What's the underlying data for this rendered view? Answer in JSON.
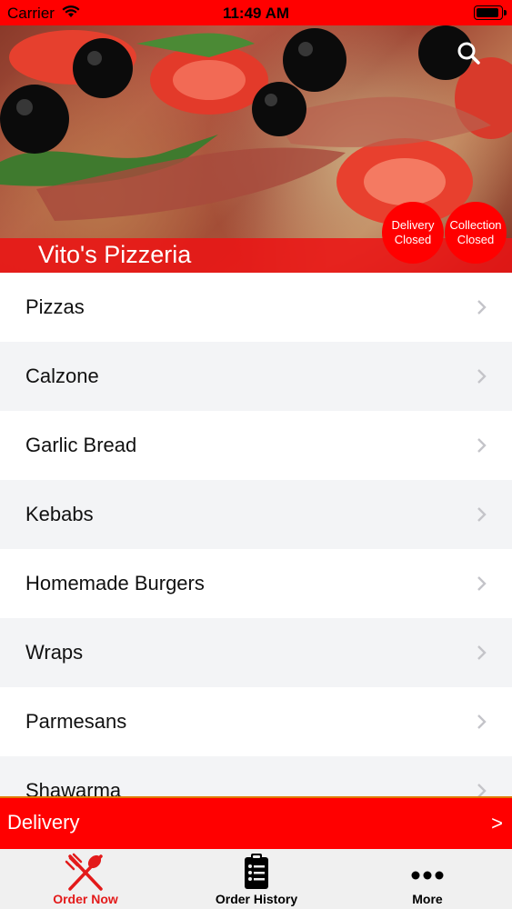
{
  "status_bar": {
    "carrier": "Carrier",
    "time": "11:49 AM"
  },
  "header": {
    "restaurant_name": "Vito's Pizzeria",
    "delivery_badge": {
      "line1": "Delivery",
      "line2": "Closed"
    },
    "collection_badge": {
      "line1": "Collection",
      "line2": "Closed"
    }
  },
  "menu": {
    "categories": [
      "Pizzas",
      "Calzone",
      "Garlic Bread",
      "Kebabs",
      "Homemade Burgers",
      "Wraps",
      "Parmesans",
      "Shawarma"
    ]
  },
  "delivery_bar": {
    "label": "Delivery",
    "arrow": ">"
  },
  "tab_bar": {
    "order_now": "Order Now",
    "order_history": "Order History",
    "more": "More"
  },
  "colors": {
    "accent": "#ff0000",
    "tab_active": "#e31a1a"
  }
}
